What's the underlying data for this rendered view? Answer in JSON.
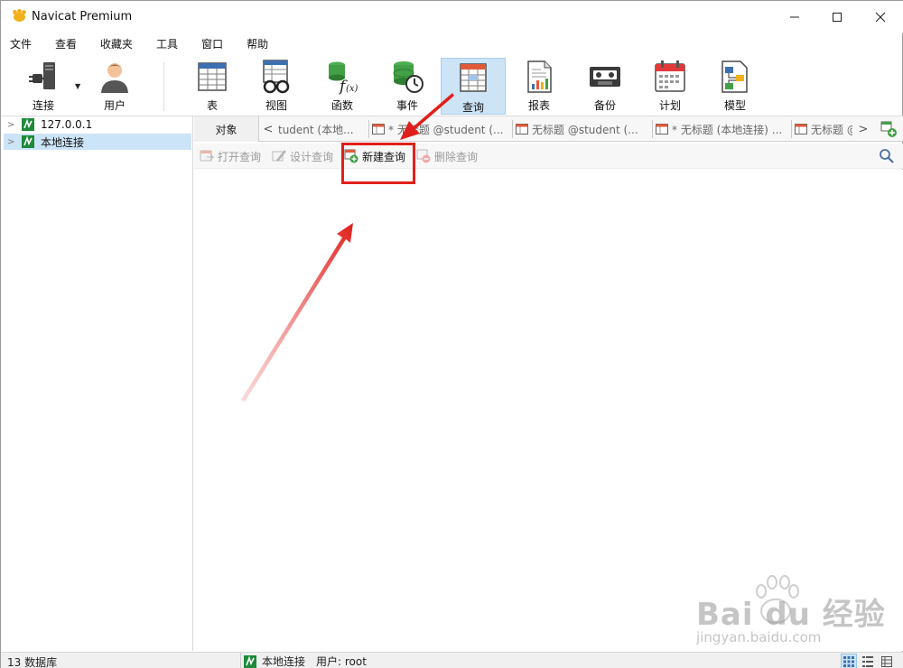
{
  "window": {
    "title": "Navicat Premium"
  },
  "menu": [
    "文件",
    "查看",
    "收藏夹",
    "工具",
    "窗口",
    "帮助"
  ],
  "toolbar": {
    "items": [
      {
        "label": "连接",
        "icon": "plug-icon"
      },
      {
        "label": "用户",
        "icon": "user-icon"
      },
      {
        "label": "表",
        "icon": "table-icon"
      },
      {
        "label": "视图",
        "icon": "view-icon"
      },
      {
        "label": "函数",
        "icon": "function-icon"
      },
      {
        "label": "事件",
        "icon": "event-icon"
      },
      {
        "label": "查询",
        "icon": "query-icon",
        "active": true
      },
      {
        "label": "报表",
        "icon": "report-icon"
      },
      {
        "label": "备份",
        "icon": "backup-icon"
      },
      {
        "label": "计划",
        "icon": "schedule-icon"
      },
      {
        "label": "模型",
        "icon": "model-icon"
      }
    ]
  },
  "tree": [
    {
      "label": "127.0.0.1",
      "selected": false
    },
    {
      "label": "本地连接",
      "selected": true
    }
  ],
  "tabs": {
    "object_label": "对象",
    "items": [
      "tudent (本地...",
      "* 无标题 @student (...",
      "无标题 @student (...",
      "* 无标题 (本地连接) ...",
      "无标题 @"
    ]
  },
  "object_toolbar": {
    "open": "打开查询",
    "design": "设计查询",
    "new": "新建查询",
    "delete": "删除查询"
  },
  "status": {
    "db_count": "13 数据库",
    "connection": "本地连接",
    "user": "用户: root"
  },
  "watermark": {
    "brand": "Bai du 经验",
    "url": "jingyan.baidu.com"
  },
  "colors": {
    "accent": "#cde4f7",
    "annotation": "#e0201c"
  }
}
